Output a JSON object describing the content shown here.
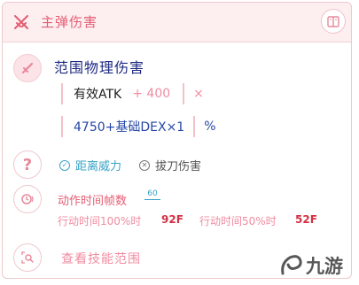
{
  "header": {
    "title": "主弹伤害",
    "icon": "crossed-swords-icon",
    "action_icon": "book-icon"
  },
  "range": {
    "title": "范围物理伤害",
    "icon": "sword-icon",
    "line1": {
      "label": "有效ATK",
      "plus": "+ 400",
      "times": "×"
    },
    "line2": {
      "formula": "4750+基础DEX×1",
      "unit": "%"
    }
  },
  "options": {
    "icon": "question-icon",
    "selected": {
      "label": "距离威力",
      "icon": "check-icon"
    },
    "unselected": {
      "label": "拔刀伤害",
      "icon": "x-circle-icon"
    }
  },
  "frames": {
    "icon": "timer-icon",
    "title": "动作时间帧数",
    "fps": "60",
    "full_label": "行动时间100%时",
    "full_value": "92F",
    "half_label": "行动时间50%时",
    "half_value": "52F"
  },
  "skill_range": {
    "label": "查看技能范围",
    "icon": "magnify-icon"
  },
  "watermark": {
    "text": "九游",
    "icon": "jiuyou-logo-icon"
  },
  "colors": {
    "accent": "#e35d73",
    "blue": "#1e2a82",
    "cyan": "#38a3c5",
    "red": "#d23044"
  }
}
